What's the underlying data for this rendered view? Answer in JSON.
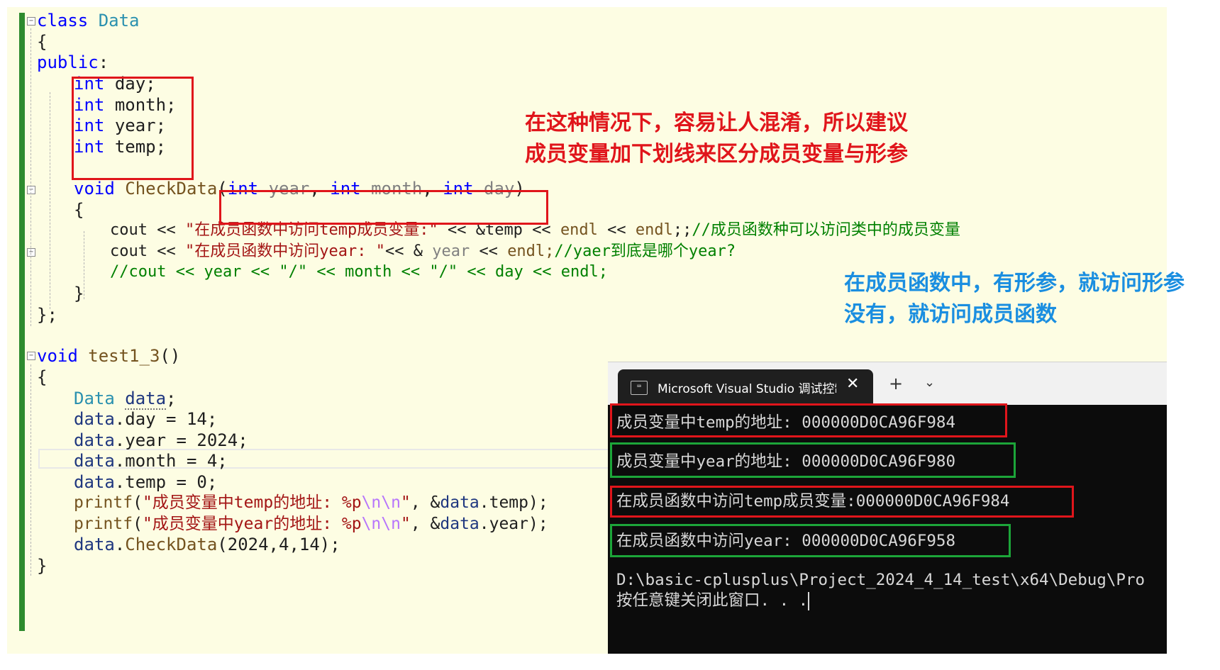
{
  "annotations": {
    "note_top": [
      "在这种情况下，容易让人混淆，所以建议",
      "成员变量加下划线来区分成员变量与形参"
    ],
    "note_right": [
      "在成员函数中，有形参，就访问形参",
      "没有，就访问成员函数"
    ]
  },
  "code": {
    "class_kw": "class",
    "class_name": "Data",
    "open_brace": "{",
    "public_kw": "public",
    "colon": ":",
    "int_kw": "int",
    "members": [
      "day;",
      "month;",
      "year;",
      "temp;"
    ],
    "void_kw": "void",
    "method_name": "CheckData",
    "paren_open": "(",
    "paren_close": ")",
    "comma": ",",
    "params": [
      "year",
      "month",
      "day"
    ],
    "cout": "cout",
    "shl": "<<",
    "str_temp": "\"在成员函数中访问temp成员变量:\"",
    "amp_temp": "&temp",
    "endl": "endl",
    "semis": ";;",
    "comment1": "//成员函数种可以访问类中的成员变量",
    "str_year": "\"在成员函数中访问year: \"",
    "amp": "&",
    "year_ref": "year",
    "endl_semi": "endl;",
    "comment2": "//yaer到底是哪个year?",
    "comment3": "//cout << year << \"/\" << month << \"/\" << day << endl;",
    "close_brace": "}",
    "class_end": "};",
    "func_name": "test1_3",
    "func_parens": "()",
    "type_data": "Data",
    "var_data": "data",
    "semi": ";",
    "data_prefix": "data",
    "assign_day": ".day = 14;",
    "assign_year": ".year = 2024;",
    "assign_month": ".month = 4;",
    "assign_temp": ".temp = 0;",
    "printf": "printf",
    "fmt_temp": "\"成员变量中temp的地址: %p",
    "fmt_year": "\"成员变量中year的地址: %p",
    "esc": "\\n\\n",
    "quote": "\"",
    "arg_temp_tail": ", &",
    "arg_temp_end": ".temp);",
    "arg_year_end": ".year);",
    "call_dot": ".",
    "call_args": "(2024,4,14);",
    "fold_minus": "−"
  },
  "console": {
    "tab_title": "Microsoft Visual Studio 调试控制台",
    "tab_icon": "⌨",
    "close_glyph": "✕",
    "plus_glyph": "+",
    "dropdown_glyph": "⌄",
    "lines": [
      "成员变量中temp的地址: 000000D0CA96F984",
      "成员变量中year的地址: 000000D0CA96F980",
      "在成员函数中访问temp成员变量:000000D0CA96F984",
      "在成员函数中访问year: 000000D0CA96F958",
      "D:\\basic-cplusplus\\Project_2024_4_14_test\\x64\\Debug\\Pro",
      "按任意键关闭此窗口. . ."
    ]
  },
  "colors": {
    "editor_bg": "#fdfde3",
    "console_bg": "#0c0c0c",
    "highlight_red": "#e0151b",
    "highlight_green": "#1ca539",
    "note_blue": "#1a8ee0"
  }
}
